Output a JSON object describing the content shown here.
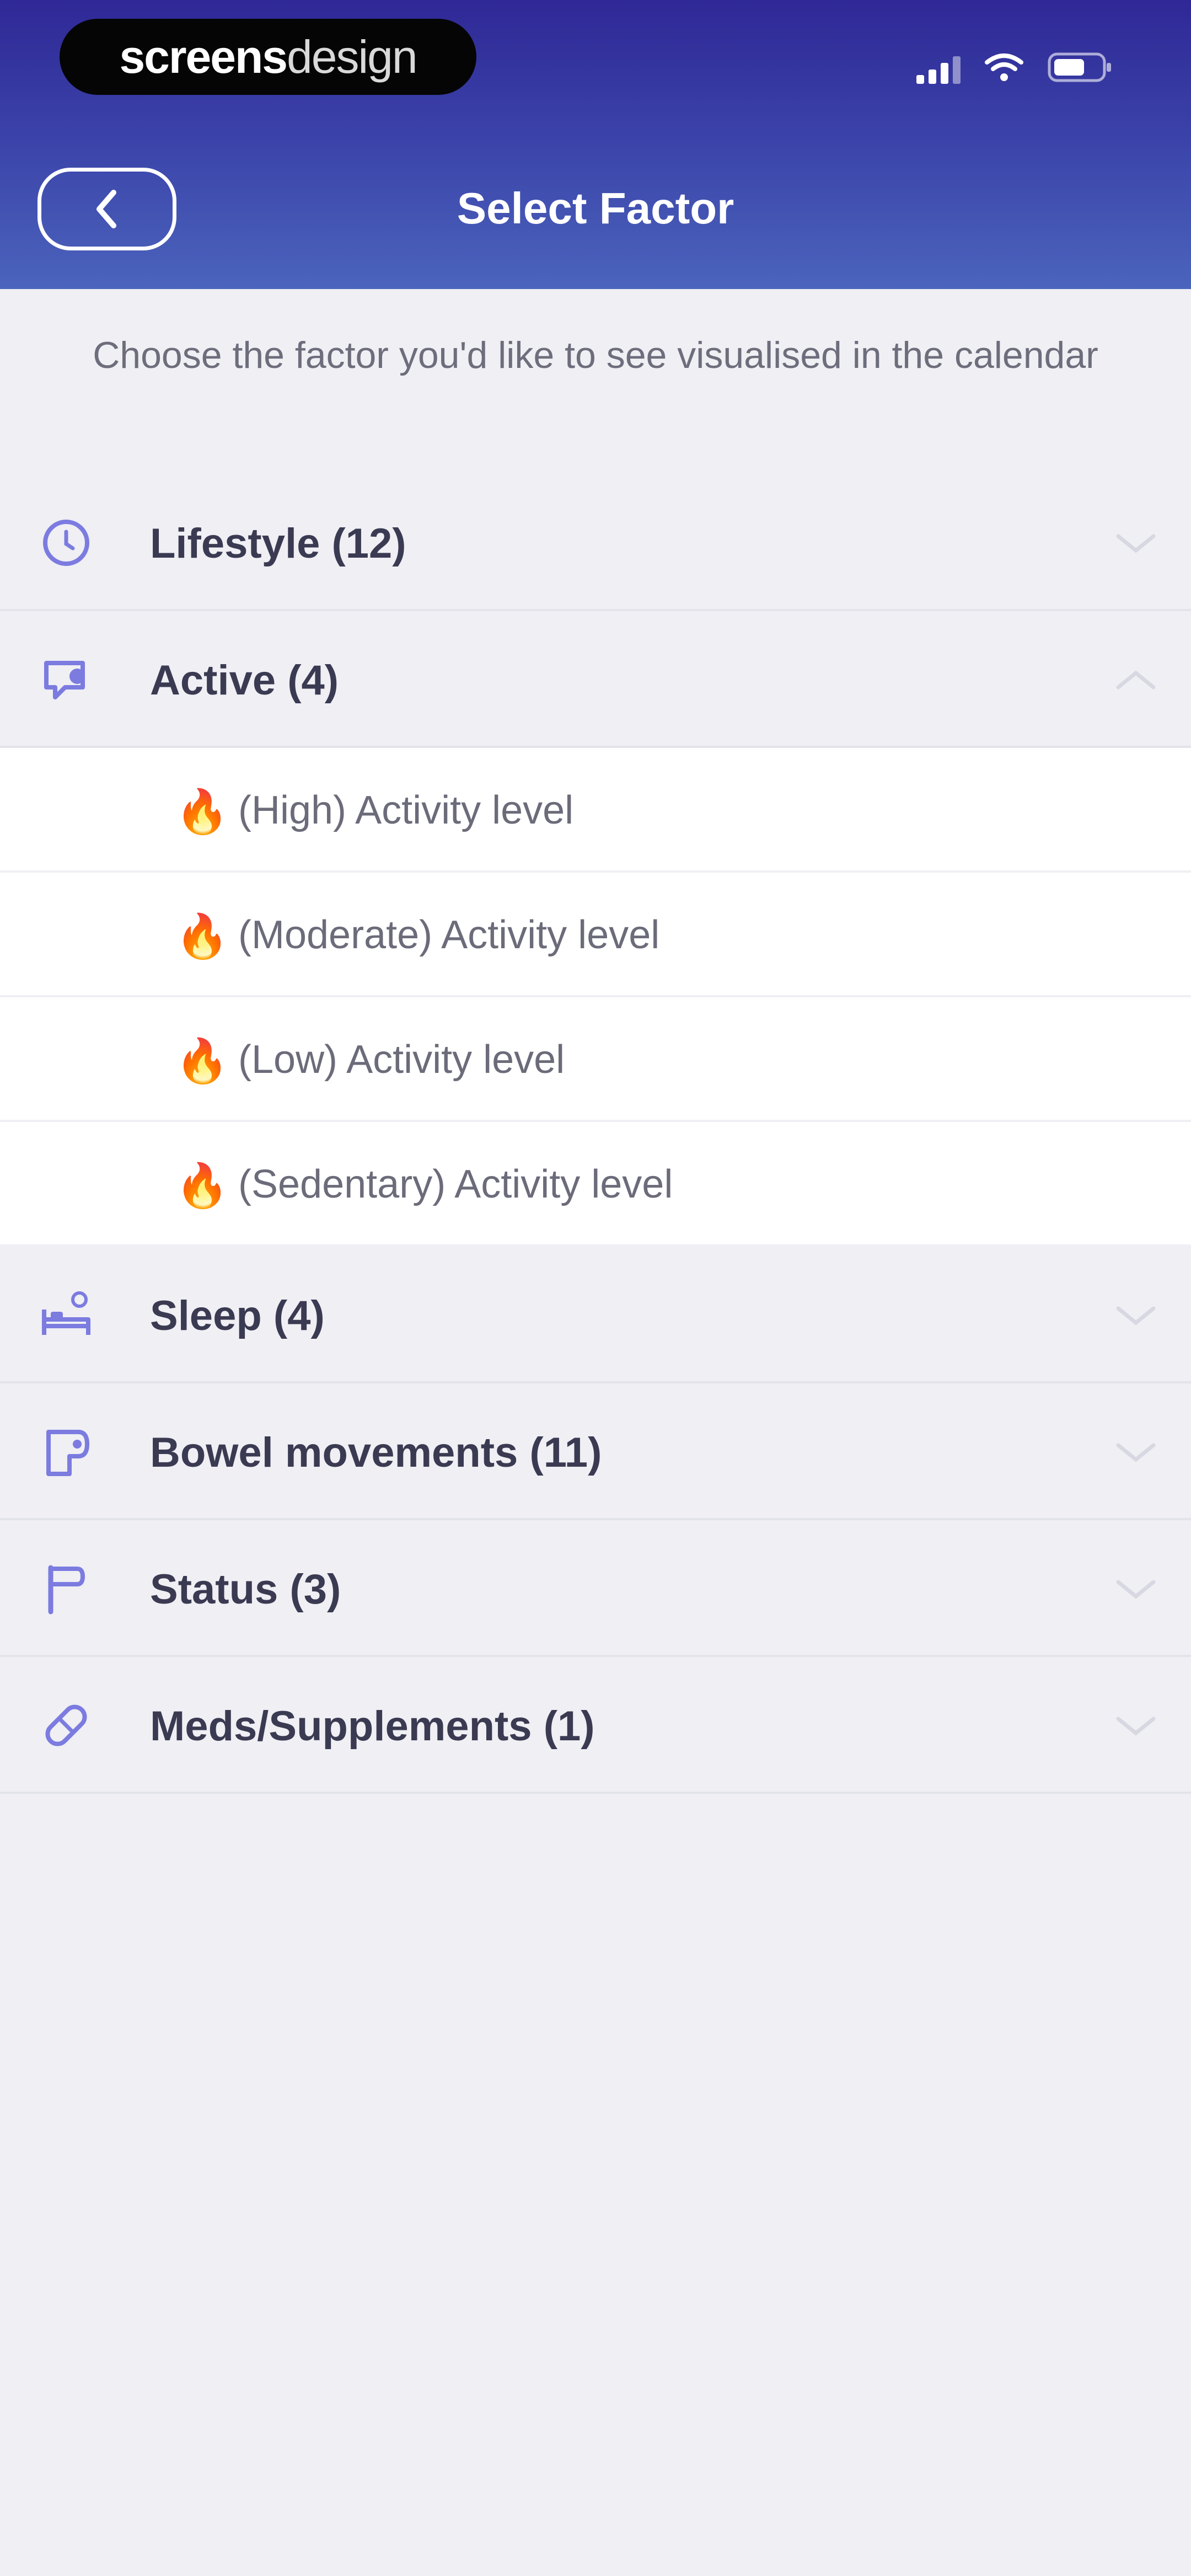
{
  "status_bar": {
    "logo_bold": "screens",
    "logo_light": "design",
    "signal_icon": "cellular-signal-icon",
    "wifi_icon": "wifi-icon",
    "battery_icon": "battery-icon"
  },
  "header": {
    "title": "Select Factor",
    "back_icon": "chevron-left-icon"
  },
  "subtitle": "Choose the factor you'd like to see visualised in the calendar",
  "categories": [
    {
      "label": "Lifestyle (12)",
      "icon": "clock-icon",
      "expanded": false
    },
    {
      "label": "Active (4)",
      "icon": "activity-chat-icon",
      "expanded": true,
      "items": [
        {
          "label": "(High) Activity level",
          "icon": "🔥"
        },
        {
          "label": "(Moderate) Activity level",
          "icon": "🔥"
        },
        {
          "label": "(Low) Activity level",
          "icon": "🔥"
        },
        {
          "label": "(Sedentary) Activity level",
          "icon": "🔥"
        }
      ]
    },
    {
      "label": "Sleep (4)",
      "icon": "bed-icon",
      "expanded": false
    },
    {
      "label": "Bowel movements (11)",
      "icon": "toilet-paper-icon",
      "expanded": false
    },
    {
      "label": "Status (3)",
      "icon": "flag-icon",
      "expanded": false
    },
    {
      "label": "Meds/Supplements (1)",
      "icon": "pill-icon",
      "expanded": false
    }
  ],
  "colors": {
    "header_top": "#2f2896",
    "header_bottom": "#4b64bc",
    "icon_accent": "#7b7be0",
    "background": "#efeff4"
  }
}
